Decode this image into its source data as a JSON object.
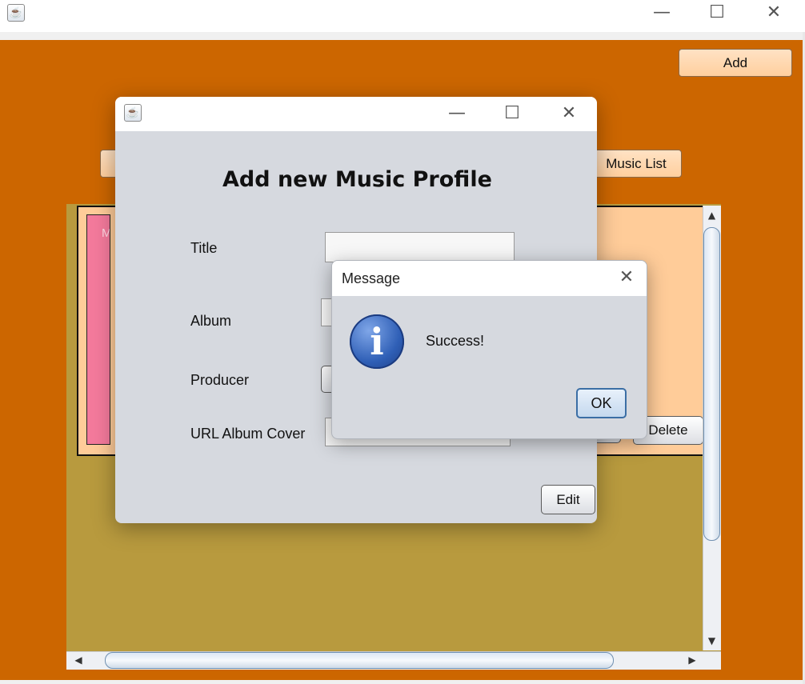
{
  "main_window": {
    "controls": {
      "minimize": "—",
      "maximize": "☐",
      "close": "✕"
    },
    "add_button": "Add",
    "music_list_button": "Music List",
    "delete_button": "Delete",
    "card_image_text": "M"
  },
  "dialog": {
    "controls": {
      "minimize": "—",
      "maximize": "☐",
      "close": "✕"
    },
    "heading": "Add new Music Profile",
    "fields": {
      "title_label": "Title",
      "album_label": "Album",
      "producer_label": "Producer",
      "url_label": "URL Album Cover"
    },
    "edit_button": "Edit"
  },
  "message": {
    "title": "Message",
    "close": "✕",
    "text": "Success!",
    "ok_button": "OK",
    "icon_glyph": "i"
  },
  "scroll": {
    "up": "▲",
    "down": "▼",
    "left": "◀",
    "right": "▶"
  },
  "icons": {
    "app": "java-icon",
    "info": "info-icon"
  },
  "colors": {
    "background": "#cc6600",
    "card": "#ffcc99",
    "panel": "#b89a3e",
    "dialog": "#d6d9df"
  }
}
